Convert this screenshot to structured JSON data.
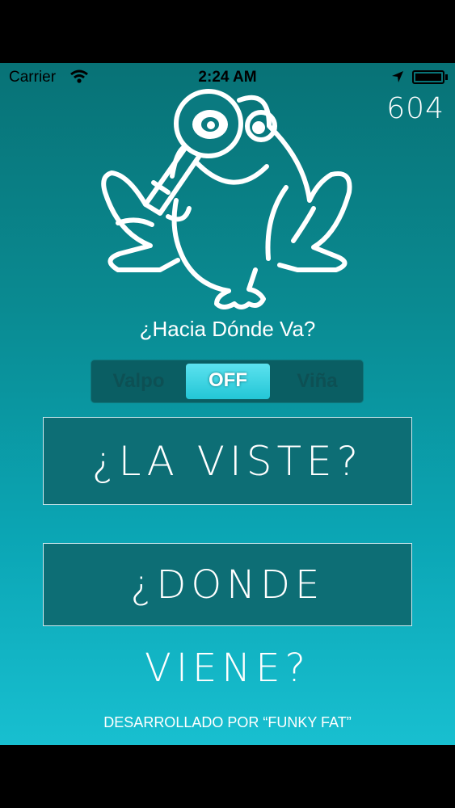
{
  "status_bar": {
    "carrier": "Carrier",
    "time": "2:24 AM"
  },
  "counter": "604",
  "question": "¿Hacia Dónde Va?",
  "selector": {
    "options": [
      "Valpo",
      "OFF",
      "Viña"
    ],
    "selected": "OFF"
  },
  "buttons": {
    "saw_it": "¿LA VISTE?",
    "where_coming": "¿DONDE VIENE?"
  },
  "footer": "DESARROLLADO POR “FUNKY FAT”",
  "colors": {
    "accent": "#23c6d6",
    "background_top": "#087276",
    "background_bottom": "#18bfd0"
  }
}
